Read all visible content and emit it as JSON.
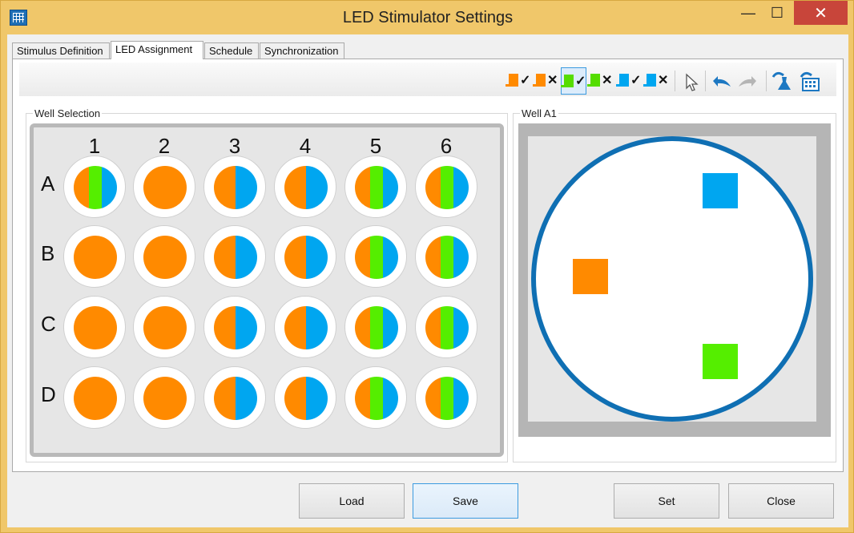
{
  "window": {
    "title": "LED Stimulator Settings",
    "minimize": "—",
    "maximize": "☐",
    "close": "✕"
  },
  "tabs": [
    {
      "label": "Stimulus Definition"
    },
    {
      "label": "LED Assignment"
    },
    {
      "label": "Schedule"
    },
    {
      "label": "Synchronization"
    }
  ],
  "active_tab": "LED Assignment",
  "toolbar": {
    "buttons": [
      {
        "icon": "orange-pulse-check-icon",
        "color": "#ff8a00",
        "mark": "✓"
      },
      {
        "icon": "orange-pulse-cross-icon",
        "color": "#ff8a00",
        "mark": "✕"
      },
      {
        "icon": "green-pulse-check-icon",
        "color": "#55dd00",
        "mark": "✓",
        "selected": true
      },
      {
        "icon": "green-pulse-cross-icon",
        "color": "#55dd00",
        "mark": "✕"
      },
      {
        "icon": "blue-pulse-check-icon",
        "color": "#00a6f0",
        "mark": "✓"
      },
      {
        "icon": "blue-pulse-cross-icon",
        "color": "#00a6f0",
        "mark": "✕"
      },
      {
        "icon": "pointer-icon"
      },
      {
        "icon": "undo-icon"
      },
      {
        "icon": "redo-icon"
      },
      {
        "icon": "flask-icon"
      },
      {
        "icon": "plate-grid-icon"
      }
    ]
  },
  "well_selection": {
    "label": "Well Selection",
    "columns": [
      "1",
      "2",
      "3",
      "4",
      "5",
      "6"
    ],
    "rows": [
      "A",
      "B",
      "C",
      "D"
    ],
    "wells": [
      [
        "ogb",
        "o",
        "ob",
        "ob",
        "ogb",
        "ogb"
      ],
      [
        "o",
        "o",
        "ob",
        "ob",
        "ogb",
        "ogb"
      ],
      [
        "o",
        "o",
        "ob",
        "ob",
        "ogb",
        "ogb"
      ],
      [
        "o",
        "o",
        "ob",
        "ob",
        "ogb",
        "ogb"
      ]
    ]
  },
  "well_detail": {
    "label": "Well A1"
  },
  "colors": {
    "orange": "#ff8a00",
    "green": "#55ee00",
    "blue": "#00a6f0",
    "ring": "#0f6fb3"
  },
  "buttons": {
    "load": "Load",
    "save": "Save",
    "set": "Set",
    "close": "Close"
  }
}
